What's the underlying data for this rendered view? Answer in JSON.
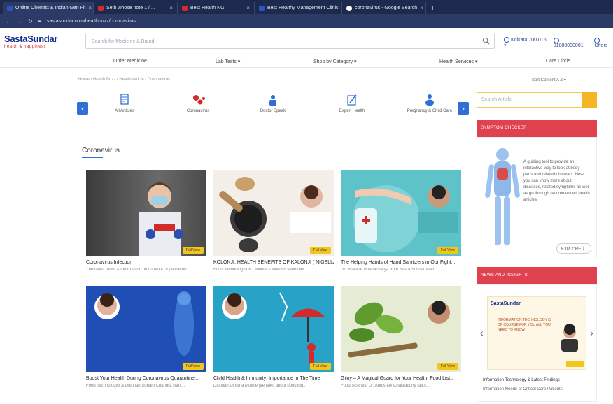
{
  "browser": {
    "tabs": [
      {
        "label": "Online Chemist & Indian Gen Fit",
        "color": "#2b57c4"
      },
      {
        "label": "Seth whose note 1 / ...",
        "color": "#d32a2a"
      },
      {
        "label": "Best Health NG",
        "color": "#d32a2a"
      },
      {
        "label": "Best Healthy Management Clinic",
        "color": "#2b57c4"
      },
      {
        "label": "coronavirus - Google Search",
        "color": "#ffffff"
      }
    ],
    "new_tab": "+",
    "url": "sastasundar.com/healthbuzz/coronavirus"
  },
  "header": {
    "logo_main": "SastaSundar",
    "logo_tag": "health & happiness",
    "search_placeholder": "Search for Medicine & Brand",
    "links": [
      "Kolkata 700 016 ▾",
      "01800000001",
      "Offers"
    ]
  },
  "nav": [
    "Order Medicine",
    "Lab Tests ▾",
    "Shop by Category ▾",
    "Health Services ▾",
    "Care Circle"
  ],
  "breadcrumb": "Home  /  Health Buzz  /  Health Article  /  Coronavirus",
  "sort": "Sort Content  A Z ▾",
  "categories": [
    "All Articles",
    "Coronavirus",
    "Doctor Speak",
    "Expert Health",
    "Pregnancy & Child Care"
  ],
  "section_title": "Coronavirus",
  "articles": [
    {
      "title": "Coronavirus Infection",
      "sub": "The latest news & information on COVID-19 pandemic...",
      "badge": "Full View"
    },
    {
      "title": "KOLONJI: HEALTH BENEFITS OF KALONJI ( NIGELLA SATIVA)",
      "sub": "Food Technologist & Dietitian's view on seed diet...",
      "badge": "Full View"
    },
    {
      "title": "The Helping Hands of Hand Sanitizers in Our Fight...",
      "sub": "Dr. Bhaskar Bhattacharya from Sasta Sundar team...",
      "badge": "Full View"
    },
    {
      "title": "Boost Your Health During Coronavirus Quarantine...",
      "sub": "Food Technologist & Dietitian Suhani Chandra Bani...",
      "badge": "Full View"
    },
    {
      "title": "Child Health & Immunity: Importance in The Time",
      "sub": "Dietitian Dinisha Mukherjee talks about boosting...",
      "badge": "Full View"
    },
    {
      "title": "Giloy – A Magical Guard for Your Health: Food List...",
      "sub": "Food Scientist Dr. Abhishek Chakraborty talks...",
      "badge": "Full View"
    }
  ],
  "sidebar": {
    "search_placeholder": "Search Article",
    "symptom_head": "SYMPTOM CHECKER",
    "symptom_text": "A guiding tool to provide an interactive way to look at body parts and related diseases. Now you can know more about diseases, related symptoms as well as go through recommended health articles.",
    "explore": "EXPLORE  〉",
    "banner_head": "NEWS AND INSIGHTS",
    "banner_logo": "SastaSundar",
    "banner_title": "INFORMATION TECHNOLOGY IS OF COURSE FOR YOU ALL YOU NEED TO KNOW",
    "caption1": "Information Technology & Latest Findings",
    "caption2": "Information Needs of Critical Care Patients"
  },
  "colors": {
    "brand_blue": "#0f2a8a",
    "brand_red": "#d32a2a",
    "accent_red": "#e0414f",
    "badge_yellow": "#f4c51a",
    "nav_blue": "#2f6fd6"
  }
}
